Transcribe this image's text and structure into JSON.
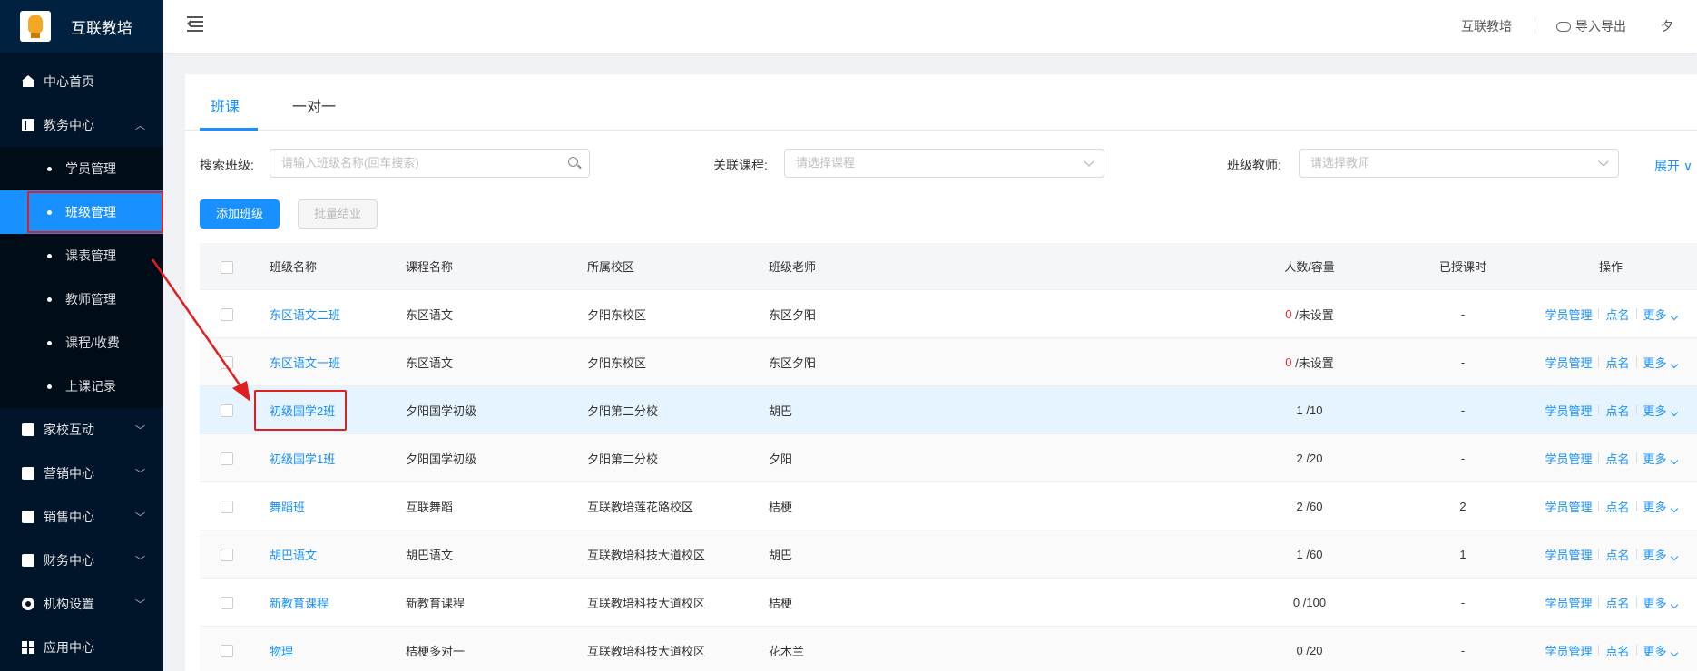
{
  "app": {
    "name": "互联教培"
  },
  "sidebar": {
    "items": [
      {
        "label": "中心首页",
        "icon": "home-icon"
      },
      {
        "label": "教务中心",
        "icon": "book-icon",
        "expanded": true,
        "children": [
          "学员管理",
          "班级管理",
          "课表管理",
          "教师管理",
          "课程/收费",
          "上课记录"
        ]
      },
      {
        "label": "家校互动",
        "icon": "interaction-icon"
      },
      {
        "label": "营销中心",
        "icon": "marketing-icon"
      },
      {
        "label": "销售中心",
        "icon": "sales-icon"
      },
      {
        "label": "财务中心",
        "icon": "finance-icon"
      },
      {
        "label": "机构设置",
        "icon": "gear-icon"
      },
      {
        "label": "应用中心",
        "icon": "grid-icon"
      }
    ],
    "active_child": "班级管理"
  },
  "header": {
    "org": "互联教培",
    "import_export": "导入导出",
    "user_initial": "夕"
  },
  "tabs": [
    "班课",
    "一对一"
  ],
  "filters": {
    "search_label": "搜索班级:",
    "search_placeholder": "请输入班级名称(回车搜索)",
    "course_label": "关联课程:",
    "course_placeholder": "请选择课程",
    "teacher_label": "班级教师:",
    "teacher_placeholder": "请选择教师",
    "expand": "展开"
  },
  "actions": {
    "add": "添加班级",
    "batch": "批量结业"
  },
  "table": {
    "headers": [
      "班级名称",
      "课程名称",
      "所属校区",
      "班级老师",
      "人数/容量",
      "已授课时",
      "操作"
    ],
    "rows": [
      {
        "name": "东区语文二班",
        "course": "东区语文",
        "campus": "夕阳东校区",
        "teacher": "东区夕阳",
        "count": "0",
        "capacity": "/未设置",
        "hours": "-"
      },
      {
        "name": "东区语文一班",
        "course": "东区语文",
        "campus": "夕阳东校区",
        "teacher": "东区夕阳",
        "count": "0",
        "capacity": "/未设置",
        "hours": "-"
      },
      {
        "name": "初级国学2班",
        "course": "夕阳国学初级",
        "campus": "夕阳第二分校",
        "teacher": "胡巴",
        "count": "1",
        "capacity": "/10",
        "hours": "-"
      },
      {
        "name": "初级国学1班",
        "course": "夕阳国学初级",
        "campus": "夕阳第二分校",
        "teacher": "夕阳",
        "count": "2",
        "capacity": "/20",
        "hours": "-"
      },
      {
        "name": "舞蹈班",
        "course": "互联舞蹈",
        "campus": "互联教培莲花路校区",
        "teacher": "桔梗",
        "count": "2",
        "capacity": "/60",
        "hours": "2"
      },
      {
        "name": "胡巴语文",
        "course": "胡巴语文",
        "campus": "互联教培科技大道校区",
        "teacher": "胡巴",
        "count": "1",
        "capacity": "/60",
        "hours": "1"
      },
      {
        "name": "新教育课程",
        "course": "新教育课程",
        "campus": "互联教培科技大道校区",
        "teacher": "桔梗",
        "count": "0",
        "capacity": "/100",
        "hours": "-"
      },
      {
        "name": "物理",
        "course": "桔梗多对一",
        "campus": "互联教培科技大道校区",
        "teacher": "花木兰",
        "count": "0",
        "capacity": "/20",
        "hours": "-"
      }
    ],
    "ops": [
      "学员管理",
      "点名",
      "更多"
    ]
  },
  "colors": {
    "primary": "#1890ff",
    "sidebar": "#001529",
    "annotation": "#e02020"
  }
}
